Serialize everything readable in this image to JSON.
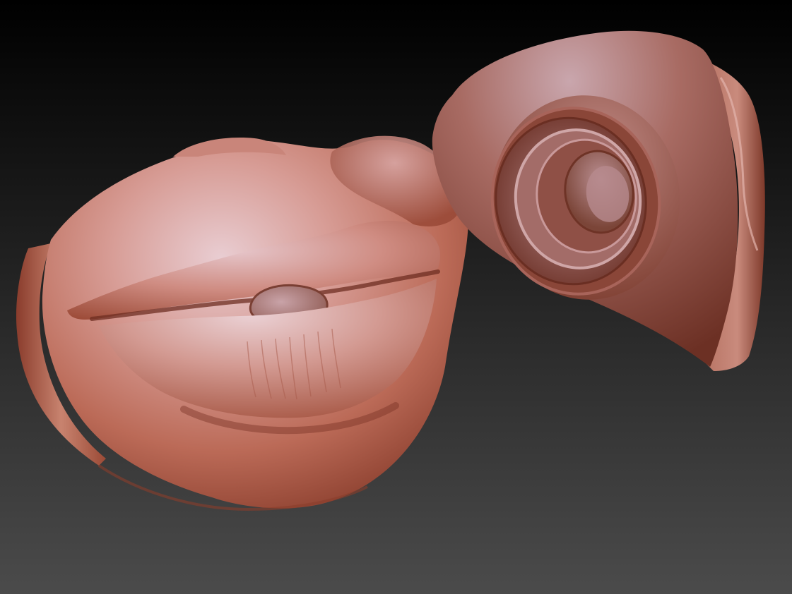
{
  "scene": {
    "background": {
      "top_color": "#000000",
      "bottom_color": "#4b4b4b"
    },
    "material": {
      "base_color": "#b96a58",
      "highlight_color": "#e8c8cc",
      "shadow_color": "#6e2e22",
      "rim_color": "#cf8672"
    },
    "objects": [
      {
        "id": "mouth-model",
        "icon": "lips-sculpt"
      },
      {
        "id": "cap-model",
        "icon": "threaded-cap-sculpt"
      }
    ]
  }
}
